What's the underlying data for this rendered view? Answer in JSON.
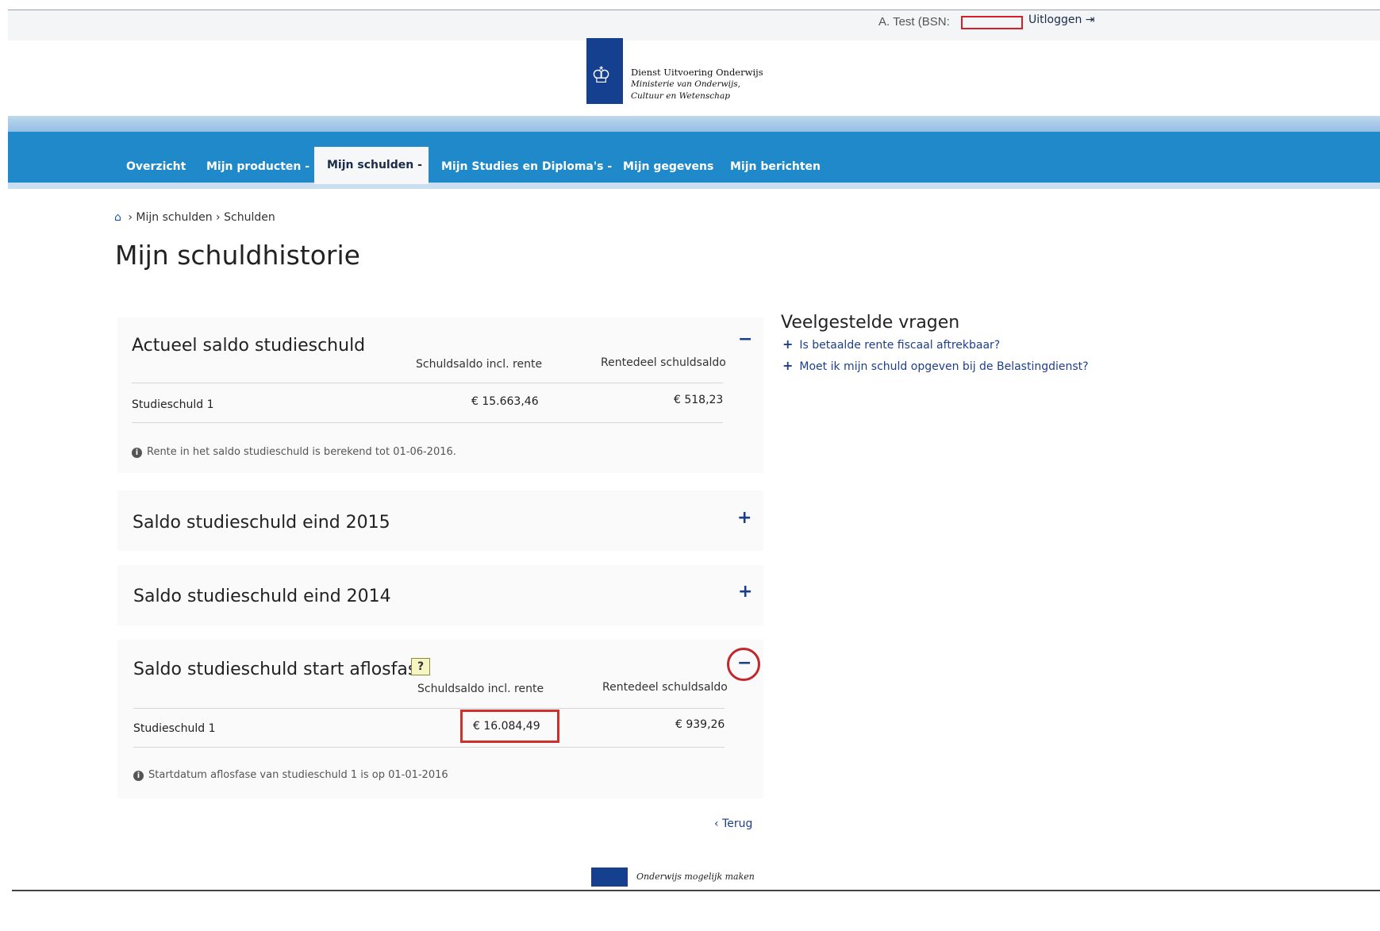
{
  "header": {
    "user_label": "A. Test (BSN:",
    "logout_label": "Uitloggen",
    "logout_icon": "logout-icon",
    "org_name": "Dienst Uitvoering Onderwijs",
    "org_sub": "Ministerie van Onderwijs, Cultuur en Wetenschap"
  },
  "nav": {
    "items": [
      {
        "label": "Overzicht"
      },
      {
        "label": "Mijn producten -"
      },
      {
        "label": "Mijn schulden -"
      },
      {
        "label": "Mijn Studies en Diploma's -"
      },
      {
        "label": "Mijn gegevens"
      },
      {
        "label": "Mijn berichten"
      }
    ],
    "active": "Mijn schulden -"
  },
  "breadcrumb": {
    "items": [
      "Mijn schulden",
      "Schulden"
    ],
    "separator": "›"
  },
  "page_title": "Mijn schuldhistorie",
  "sections": {
    "actueel": {
      "title": "Actueel saldo studieschuld",
      "toggle": "−",
      "col1": "Schuldsaldo incl. rente",
      "col2": "Rentedeel schuldsaldo",
      "row_label": "Studieschuld 1",
      "row_val1": "€ 15.663,46",
      "row_val2": "€ 518,23",
      "note": "Rente in het saldo studieschuld is berekend tot 01-06-2016."
    },
    "eind2015": {
      "title": "Saldo studieschuld eind 2015",
      "toggle": "+"
    },
    "eind2014": {
      "title": "Saldo studieschuld eind 2014",
      "toggle": "+"
    },
    "aflosfase": {
      "title": "Saldo studieschuld start aflosfase",
      "help": "?",
      "toggle": "−",
      "col1": "Schuldsaldo incl. rente",
      "col2": "Rentedeel schuldsaldo",
      "row_label": "Studieschuld 1",
      "row_val1": "€ 16.084,49",
      "row_val2": "€ 939,26",
      "note": "Startdatum aflosfase van studieschuld 1 is op 01-01-2016"
    }
  },
  "faq": {
    "title": "Veelgestelde vragen",
    "items": [
      {
        "label": "Is betaalde rente fiscaal aftrekbaar?"
      },
      {
        "label": "Moet ik mijn schuld opgeven bij de Belastingdienst?"
      }
    ]
  },
  "back_label": "‹ Terug",
  "footer": {
    "tagline": "Onderwijs mogelijk maken"
  },
  "colors": {
    "nav_blue": "#1f89c9",
    "brand_blue": "#15408f",
    "link_blue": "#1d3f8a",
    "annotation_red": "#d0302a"
  }
}
